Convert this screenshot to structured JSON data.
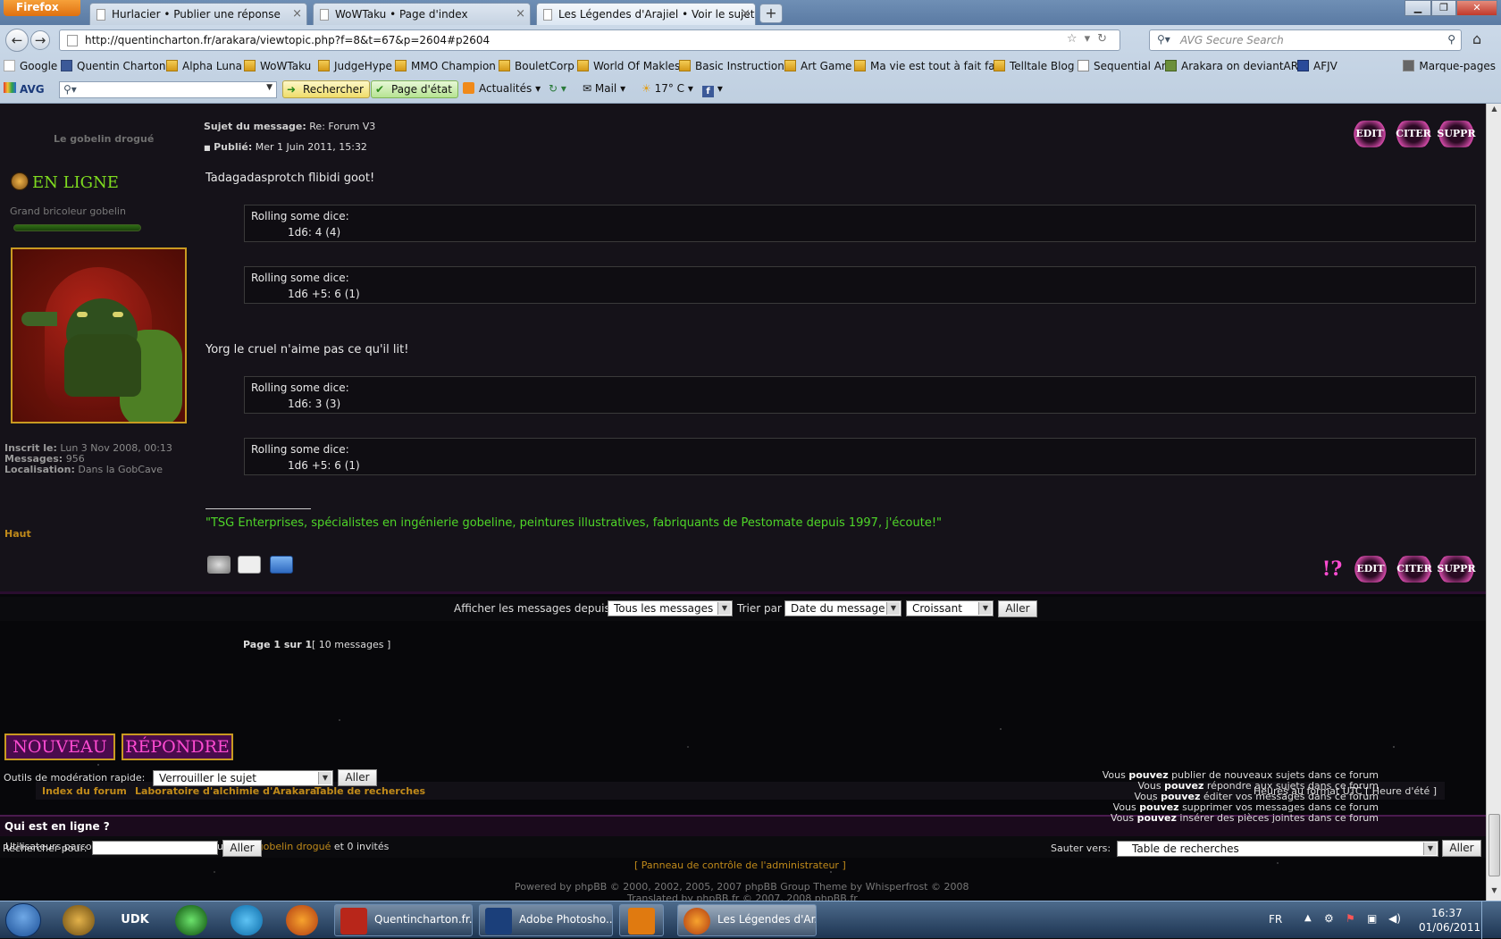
{
  "browser": {
    "app_button": "Firefox",
    "tabs": [
      {
        "label": "Hurlacier • Publier une réponse"
      },
      {
        "label": "WoWTaku • Page d'index"
      },
      {
        "label": "Les Légendes d'Arajiel • Voir le sujet -..."
      }
    ],
    "url": "http://quentincharton.fr/arakara/viewtopic.php?f=8&t=67&p=2604#p2604",
    "search_placeholder": "AVG Secure Search",
    "bookmarks": [
      "Google",
      "Quentin Charton",
      "Alpha Luna",
      "WoWTaku",
      "JudgeHype",
      "MMO Champion",
      "BouletCorp",
      "World Of Makles",
      "Basic Instructions",
      "Art Game",
      "Ma vie est tout à fait fa...",
      "Telltale Blog",
      "Sequential Art",
      "Arakara on deviantART",
      "AFJV"
    ],
    "bookmarks_menu": "Marque-pages",
    "avg": {
      "logo": "AVG",
      "search": "Rechercher",
      "status": "Page d'état",
      "news": "Actualités",
      "mail": "Mail",
      "weather": "17° C"
    }
  },
  "post": {
    "author": "Le gobelin drogué",
    "online": "EN LIGNE",
    "rank": "Grand bricoleur gobelin",
    "joined_label": "Inscrit le:",
    "joined": "Lun 3 Nov 2008, 00:13",
    "messages_label": "Messages:",
    "messages": "956",
    "location_label": "Localisation:",
    "location": "Dans la GobCave",
    "subject_label": "Sujet du message:",
    "subject": "Re: Forum V3",
    "posted_label": "Publié:",
    "posted": "Mer 1 Juin 2011, 15:32",
    "line1": "Tadagadasprotch flibidi goot!",
    "line2": "Yorg le cruel n'aime pas ce qu'il lit!",
    "dice_title": "Rolling some dice:",
    "rolls": [
      "1d6: 4 (4)",
      "1d6 +5: 6 (1)",
      "1d6: 3 (3)",
      "1d6 +5: 6 (1)"
    ],
    "signature": "\"TSG Enterprises, spécialistes en ingénierie gobeline, peintures illustratives, fabriquants de Pestomate depuis 1997, j'écoute!\"",
    "top_link": "Haut",
    "actions": {
      "edit": "EDIT",
      "quote": "CITER",
      "delete": "SUPPR",
      "report": "!?"
    }
  },
  "sort": {
    "display_label": "Afficher les messages depuis:",
    "display_value": "Tous les messages",
    "sort_label": "Trier par",
    "sort_value": "Date du message",
    "order_value": "Croissant",
    "go": "Aller"
  },
  "pagination": {
    "new": "NOUVEAU",
    "reply": "RÉPONDRE",
    "page": "Page 1 sur 1",
    "count": "[ 10 messages ]"
  },
  "navlinks": {
    "index": "Index du forum",
    "lab": "Laboratoire d'alchimie d'Arakara",
    "table": "Table de recherches",
    "timezone": "Heures au format UTC [ Heure d'été ]"
  },
  "who": {
    "title": "Qui est en ligne ?",
    "prefix": "Utilisateurs parcourant actuellement ce forum :",
    "user": "Le gobelin drogué",
    "suffix": "et 0 invités"
  },
  "moderation": {
    "label": "Outils de modération rapide:",
    "value": "Verrouiller le sujet",
    "go": "Aller"
  },
  "permissions": [
    {
      "pre": "Vous",
      "b": "pouvez",
      "post": "publier de nouveaux sujets dans ce forum"
    },
    {
      "pre": "Vous",
      "b": "pouvez",
      "post": "répondre aux sujets dans ce forum"
    },
    {
      "pre": "Vous",
      "b": "pouvez",
      "post": "éditer vos messages dans ce forum"
    },
    {
      "pre": "Vous",
      "b": "pouvez",
      "post": "supprimer vos messages dans ce forum"
    },
    {
      "pre": "Vous",
      "b": "pouvez",
      "post": "insérer des pièces jointes dans ce forum"
    }
  ],
  "search": {
    "label": "Rechercher pour:",
    "go": "Aller"
  },
  "jump": {
    "label": "Sauter vers:",
    "value": "Table de recherches",
    "go": "Aller"
  },
  "admin_link": "[ Panneau de contrôle de l'administrateur ]",
  "footer": {
    "powered": "Powered by phpBB © 2000, 2002, 2005, 2007 phpBB Group Theme by Whisperfrost © 2008",
    "translated": "Translated by phpBB.fr © 2007, 2008 phpBB.fr"
  },
  "taskbar": {
    "tasks": [
      "Quentincharton.fr...",
      "Adobe Photosho...",
      "Les Légendes d'Ar..."
    ],
    "lang": "FR",
    "time": "16:37",
    "date": "01/06/2011",
    "udk": "UDK"
  },
  "colors": {
    "link": "#c08a1a",
    "online": "#7fdc1f",
    "signature": "#4fd629",
    "accent": "#ff4bd2"
  }
}
